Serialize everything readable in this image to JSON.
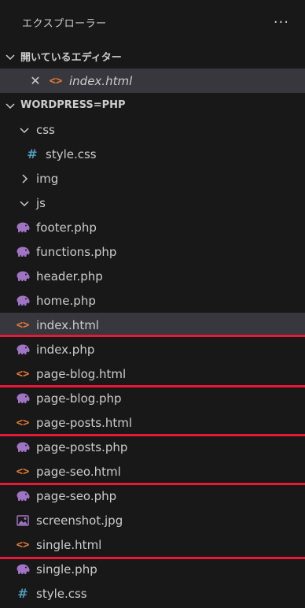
{
  "explorer": {
    "title": "エクスプローラー",
    "more_label": "···"
  },
  "open_editors": {
    "title": "開いているエディター",
    "items": [
      {
        "name": "index.html",
        "icon": "html-icon"
      }
    ]
  },
  "workspace": {
    "title": "WORDPRESS=PHP",
    "css_folder": "css",
    "css_file": "style.css",
    "img_folder": "img",
    "js_folder": "js",
    "files": [
      {
        "name": "footer.php",
        "icon": "php-icon"
      },
      {
        "name": "functions.php",
        "icon": "php-icon"
      },
      {
        "name": "header.php",
        "icon": "php-icon"
      },
      {
        "name": "home.php",
        "icon": "php-icon"
      },
      {
        "name": "index.html",
        "icon": "html-icon"
      },
      {
        "name": "index.php",
        "icon": "php-icon"
      },
      {
        "name": "page-blog.html",
        "icon": "html-icon"
      },
      {
        "name": "page-blog.php",
        "icon": "php-icon"
      },
      {
        "name": "page-posts.html",
        "icon": "html-icon"
      },
      {
        "name": "page-posts.php",
        "icon": "php-icon"
      },
      {
        "name": "page-seo.html",
        "icon": "html-icon"
      },
      {
        "name": "page-seo.php",
        "icon": "php-icon"
      },
      {
        "name": "screenshot.jpg",
        "icon": "image-icon"
      },
      {
        "name": "single.html",
        "icon": "html-icon"
      },
      {
        "name": "single.php",
        "icon": "php-icon"
      },
      {
        "name": "style.css",
        "icon": "css-icon"
      }
    ]
  },
  "colors": {
    "background": "#181818",
    "selected_row": "#37373d",
    "highlight_line": "#e81838",
    "html_icon": "#e37933",
    "php_icon": "#a074c4",
    "css_icon": "#519aba"
  }
}
